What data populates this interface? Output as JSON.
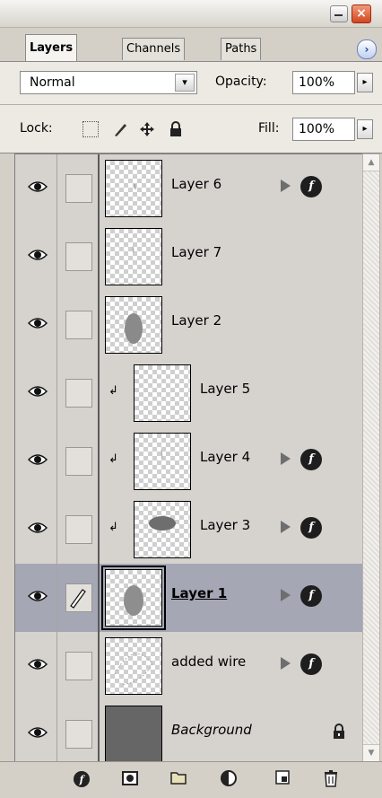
{
  "panel": {
    "tabs": [
      "Layers",
      "Channels",
      "Paths"
    ],
    "blend_mode": "Normal",
    "opacity_label": "Opacity:",
    "opacity_value": "100%",
    "lock_label": "Lock:",
    "fill_label": "Fill:",
    "fill_value": "100%"
  },
  "layers": [
    {
      "name": "Layer 6",
      "clipped": false,
      "has_fx": true,
      "selected": false
    },
    {
      "name": "Layer 7",
      "clipped": false,
      "has_fx": false,
      "selected": false
    },
    {
      "name": "Layer 2",
      "clipped": false,
      "has_fx": false,
      "selected": false
    },
    {
      "name": "Layer 5",
      "clipped": true,
      "has_fx": false,
      "selected": false
    },
    {
      "name": "Layer 4",
      "clipped": true,
      "has_fx": true,
      "selected": false
    },
    {
      "name": "Layer 3",
      "clipped": true,
      "has_fx": true,
      "selected": false
    },
    {
      "name": "Layer 1",
      "clipped": false,
      "has_fx": true,
      "selected": true
    },
    {
      "name": "added wire",
      "clipped": false,
      "has_fx": true,
      "selected": false
    },
    {
      "name": "Background",
      "clipped": false,
      "has_fx": false,
      "selected": false,
      "locked": true
    }
  ],
  "icons": {
    "close": "×",
    "menu": "›",
    "dropdown": "▾",
    "step": "▸",
    "clip_arrow": "↲",
    "fx": "f"
  }
}
